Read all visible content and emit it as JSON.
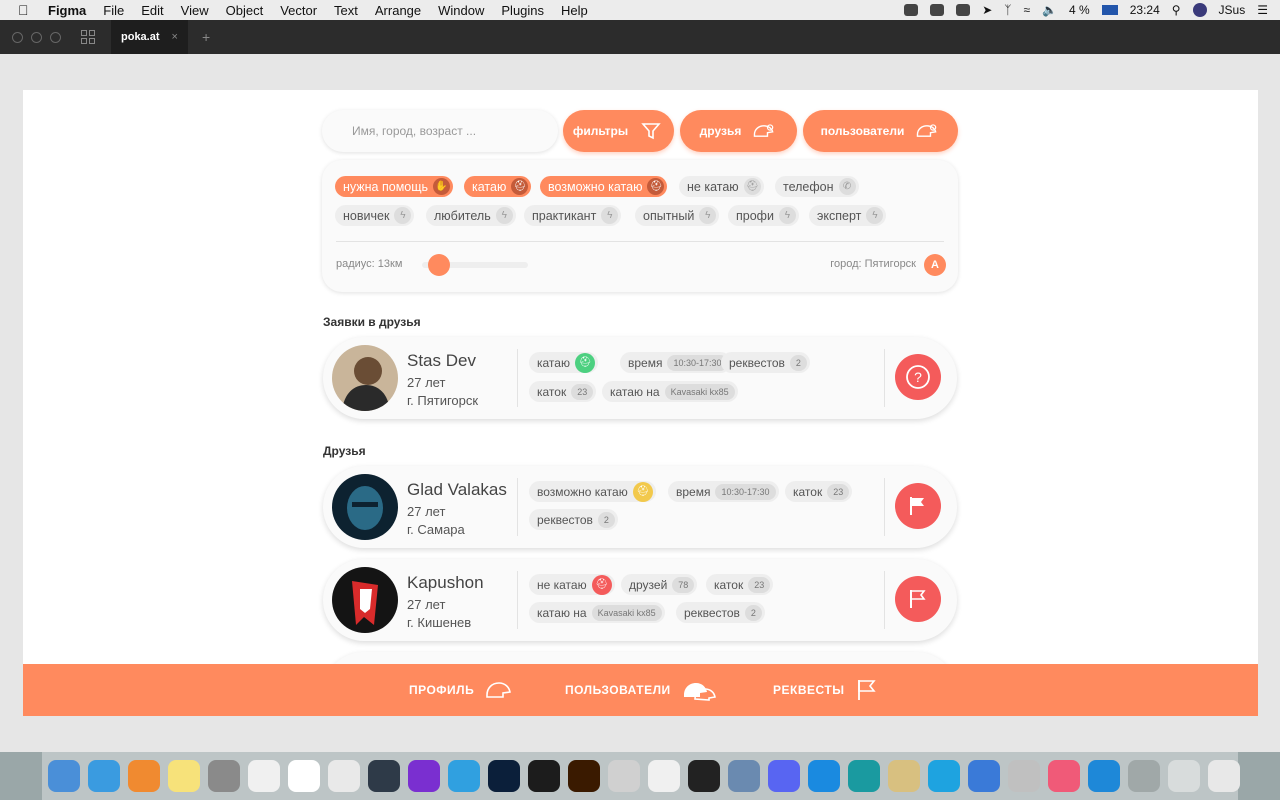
{
  "menubar": {
    "app": "Figma",
    "items": [
      "File",
      "Edit",
      "View",
      "Object",
      "Vector",
      "Text",
      "Arrange",
      "Window",
      "Plugins",
      "Help"
    ],
    "battery": "4 %",
    "time": "23:24",
    "user": "JSus"
  },
  "tabbar": {
    "tab_title": "poka.at"
  },
  "search": {
    "placeholder": "Имя, город, возраст ..."
  },
  "topbuttons": {
    "filters": "фильтры",
    "friends": "друзья",
    "users": "пользователи"
  },
  "filters": {
    "row1": [
      {
        "label": "нужна помощь",
        "active": true
      },
      {
        "label": "катаю",
        "active": true
      },
      {
        "label": "возможно катаю",
        "active": true
      },
      {
        "label": "не катаю",
        "active": false
      },
      {
        "label": "телефон",
        "active": false
      }
    ],
    "row2": [
      {
        "label": "новичек"
      },
      {
        "label": "любитель"
      },
      {
        "label": "практикант"
      },
      {
        "label": "опытный"
      },
      {
        "label": "профи"
      },
      {
        "label": "эксперт"
      }
    ],
    "radius": "радиус: 13км",
    "city": "город: Пятигорск",
    "city_icon": "A"
  },
  "sections": {
    "requests": "Заявки в друзья",
    "friends": "Друзья"
  },
  "request_card": {
    "name": "Stas Dev",
    "age": "27 лет",
    "city": "г. Пятигорск",
    "tags": {
      "katayu": "катаю",
      "time": "время",
      "time_val": "10:30-17:30",
      "requests": "реквестов",
      "requests_val": "2",
      "katok": "каток",
      "katok_val": "23",
      "ride_on": "катаю на",
      "ride_on_val": "Kavasaki kx85"
    }
  },
  "friend1": {
    "name": "Glad Valakas",
    "age": "27 лет",
    "city": "г. Самара",
    "tags": {
      "maybe": "возможно катаю",
      "time": "время",
      "time_val": "10:30-17:30",
      "katok": "каток",
      "katok_val": "23",
      "requests": "реквестов",
      "requests_val": "2"
    }
  },
  "friend2": {
    "name": "Kapushon",
    "age": "27 лет",
    "city": "г. Кишенев",
    "tags": {
      "no": "не катаю",
      "friends": "друзей",
      "friends_val": "78",
      "katok": "каток",
      "katok_val": "23",
      "ride_on": "катаю на",
      "ride_on_val": "Kavasaki kx85",
      "requests": "реквестов",
      "requests_val": "2"
    }
  },
  "bottomnav": {
    "profile": "ПРОФИЛЬ",
    "users": "ПОЛЬЗОВАТЕЛИ",
    "requests": "РЕКВЕСТЫ"
  },
  "colors": {
    "accent": "#ff8a5e",
    "danger": "#f45b5b",
    "green": "#4cd080",
    "yellow": "#f2c94c"
  },
  "dock_icons": [
    "finder-icon",
    "safari-icon",
    "ibooks-icon",
    "notes-icon",
    "system-preferences-icon",
    "photos-icon",
    "yandex-icon",
    "chrome-icon",
    "atom-icon",
    "podcast-icon",
    "telegram-icon",
    "photoshop-icon",
    "terminal-icon",
    "illustrator-icon",
    "utility-icon",
    "sketch-icon",
    "figma-icon",
    "virtualbox-icon",
    "discord-icon",
    "teamviewer-icon",
    "arduino-icon",
    "preview-icon",
    "skype-icon",
    "xcode-icon",
    "script-icon",
    "itunes-icon",
    "vscode-icon",
    "font-icon",
    "downloads-icon",
    "trash-icon"
  ]
}
